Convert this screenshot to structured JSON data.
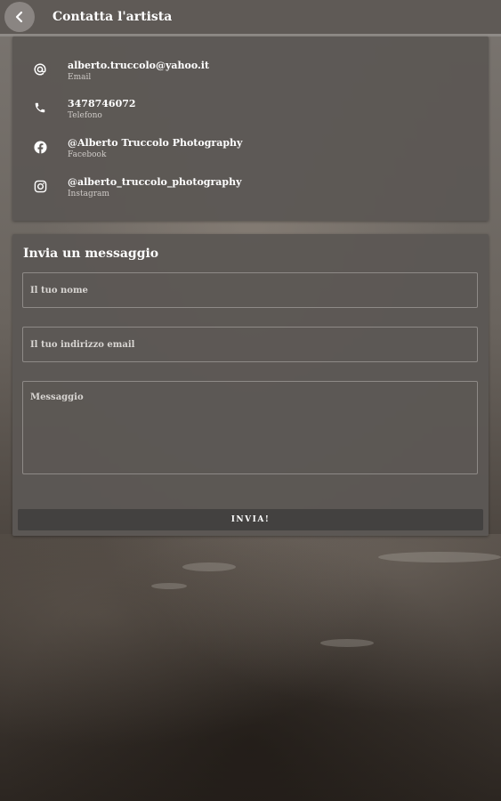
{
  "header": {
    "title": "Contatta l'artista"
  },
  "contacts": [
    {
      "icon": "at-icon",
      "value": "alberto.truccolo@yahoo.it",
      "label": "Email"
    },
    {
      "icon": "phone-icon",
      "value": "3478746072",
      "label": "Telefono"
    },
    {
      "icon": "facebook-icon",
      "value": "@Alberto Truccolo Photography",
      "label": "Facebook"
    },
    {
      "icon": "instagram-icon",
      "value": "@alberto_truccolo_photography",
      "label": "Instagram"
    }
  ],
  "form": {
    "title": "Invia un messaggio",
    "name_placeholder": "Il tuo nome",
    "email_placeholder": "Il tuo indirizzo email",
    "message_placeholder": "Messaggio",
    "submit_label": "INVIA!"
  }
}
